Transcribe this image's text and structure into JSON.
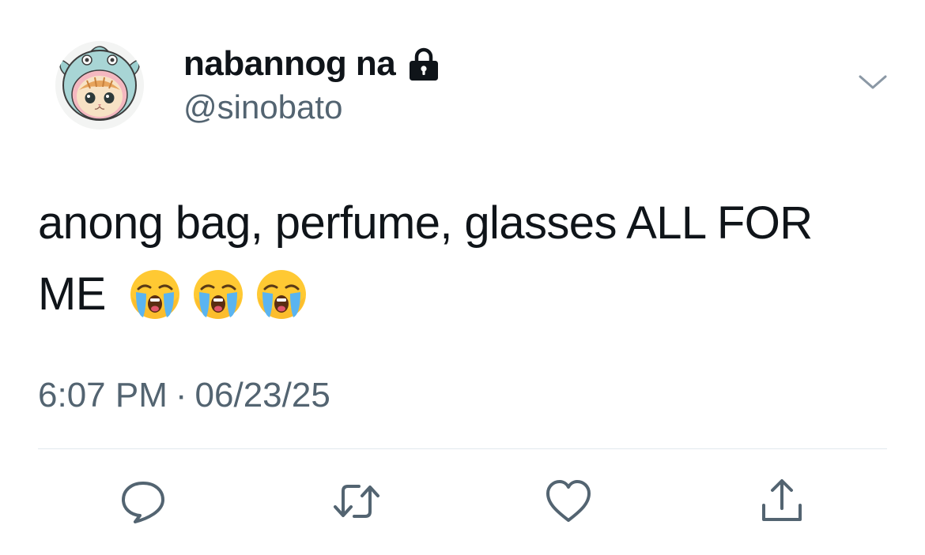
{
  "user": {
    "display_name": "nabannog na",
    "handle": "@sinobato",
    "protected_icon": "lock-icon",
    "avatar": "cat-in-fish-hood-avatar"
  },
  "tweet": {
    "text": "anong bag, perfume, glasses ALL FOR ME",
    "emojis": [
      "😭",
      "😭",
      "😭"
    ],
    "time": "6:07 PM",
    "separator": "·",
    "date": "06/23/25"
  },
  "actions": [
    {
      "icon": "reply-icon"
    },
    {
      "icon": "retweet-icon"
    },
    {
      "icon": "like-icon"
    },
    {
      "icon": "share-icon"
    }
  ],
  "colors": {
    "text": "#0f1419",
    "secondary": "#536471",
    "divider": "#e1e8ed",
    "icon": "#536471"
  }
}
